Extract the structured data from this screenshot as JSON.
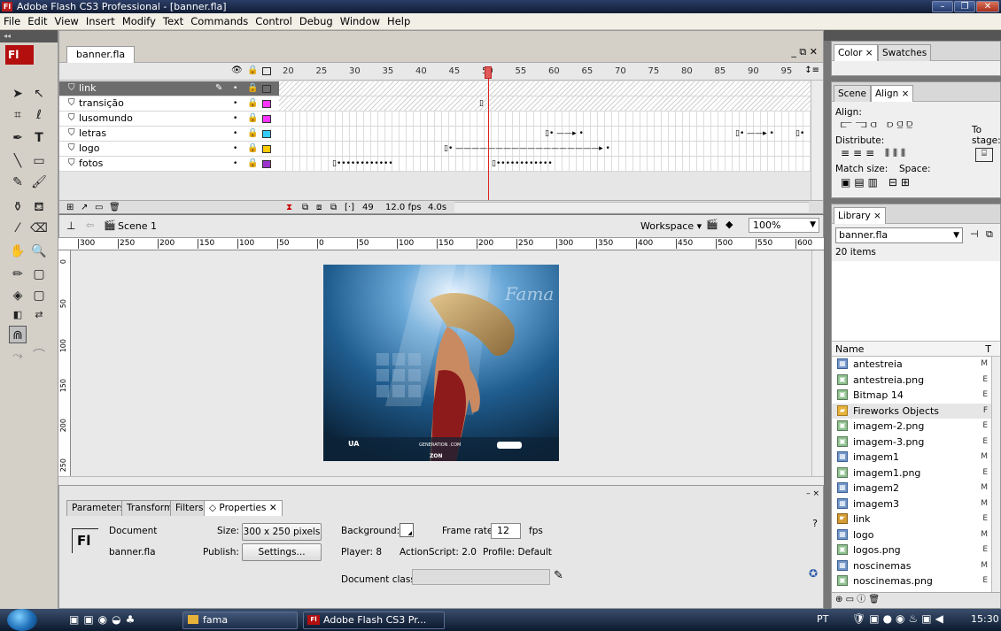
{
  "window": {
    "title": "Adobe Flash CS3 Professional - [banner.fla]",
    "app_badge": "Fl"
  },
  "menu": [
    "File",
    "Edit",
    "View",
    "Insert",
    "Modify",
    "Text",
    "Commands",
    "Control",
    "Debug",
    "Window",
    "Help"
  ],
  "toolbar": {
    "logo": "Fl"
  },
  "document_tab": "banner.fla",
  "timeline": {
    "ruler_numbers": [
      "20",
      "25",
      "30",
      "35",
      "40",
      "45",
      "50",
      "55",
      "60",
      "65",
      "70",
      "75",
      "80",
      "85",
      "90",
      "95"
    ],
    "layers": [
      {
        "name": "link",
        "selected": true
      },
      {
        "name": "transição",
        "color": "#ff33ff"
      },
      {
        "name": "lusomundo",
        "color": "#ff33ff"
      },
      {
        "name": "letras",
        "color": "#33ccff"
      },
      {
        "name": "logo",
        "color": "#ffcc00"
      },
      {
        "name": "fotos",
        "color": "#9933cc"
      }
    ],
    "current_frame": "49",
    "frame_rate": "12.0 fps",
    "elapsed": "4.0s"
  },
  "scene": {
    "name": "Scene 1",
    "workspace": "Workspace",
    "zoom": "100%"
  },
  "hruler_labels": [
    "300",
    "250",
    "200",
    "150",
    "100",
    "50",
    "0",
    "50",
    "100",
    "150",
    "200",
    "250",
    "300",
    "350",
    "400",
    "450",
    "500",
    "550",
    "600"
  ],
  "vruler_labels": [
    "0",
    "50",
    "100",
    "150",
    "200",
    "250"
  ],
  "banner_text": {
    "brand": "Fama",
    "url": "GENERATION  .COM",
    "zon": "ZON"
  },
  "properties": {
    "tabs": [
      "Parameters",
      "Transform",
      "Filters",
      "Properties"
    ],
    "logo": "Fl",
    "document_label": "Document",
    "document_name": "banner.fla",
    "size_label": "Size:",
    "size_value": "300 x 250 pixels",
    "publish_label": "Publish:",
    "settings_button": "Settings...",
    "background_label": "Background:",
    "frame_rate_label": "Frame rate:",
    "frame_rate_value": "12",
    "fps": "fps",
    "player": "Player:  8",
    "actionscript": "ActionScript:  2.0",
    "profile": "Profile:  Default",
    "document_class_label": "Document class:"
  },
  "panels": {
    "color_tabs": [
      "Color",
      "Swatches"
    ],
    "align_tabs": [
      "Scene",
      "Align"
    ],
    "align_label": "Align:",
    "distribute_label": "Distribute:",
    "match_size_label": "Match size:",
    "space_label": "Space:",
    "to_stage": "To stage:",
    "library_tab": "Library",
    "library_doc": "banner.fla",
    "library_count": "20 items",
    "library_name_header": "Name",
    "library_type_header": "T",
    "library_items": [
      {
        "name": "antestreia",
        "type": "M",
        "kind": "movie"
      },
      {
        "name": "antestreia.png",
        "type": "E",
        "kind": "bitmap"
      },
      {
        "name": "Bitmap 14",
        "type": "E",
        "kind": "bitmap"
      },
      {
        "name": "Fireworks Objects",
        "type": "F",
        "kind": "folder"
      },
      {
        "name": "imagem-2.png",
        "type": "E",
        "kind": "bitmap"
      },
      {
        "name": "imagem-3.png",
        "type": "E",
        "kind": "bitmap"
      },
      {
        "name": "imagem1",
        "type": "M",
        "kind": "movie"
      },
      {
        "name": "imagem1.png",
        "type": "E",
        "kind": "bitmap"
      },
      {
        "name": "imagem2",
        "type": "M",
        "kind": "movie"
      },
      {
        "name": "imagem3",
        "type": "M",
        "kind": "movie"
      },
      {
        "name": "link",
        "type": "E",
        "kind": "button"
      },
      {
        "name": "logo",
        "type": "M",
        "kind": "movie"
      },
      {
        "name": "logos.png",
        "type": "E",
        "kind": "bitmap"
      },
      {
        "name": "noscinemas",
        "type": "M",
        "kind": "movie"
      },
      {
        "name": "noscinemas.png",
        "type": "E",
        "kind": "bitmap"
      }
    ]
  },
  "taskbar": {
    "tasks": [
      "fama",
      "Adobe Flash CS3 Pr..."
    ],
    "lang": "PT",
    "clock": "15:30"
  }
}
